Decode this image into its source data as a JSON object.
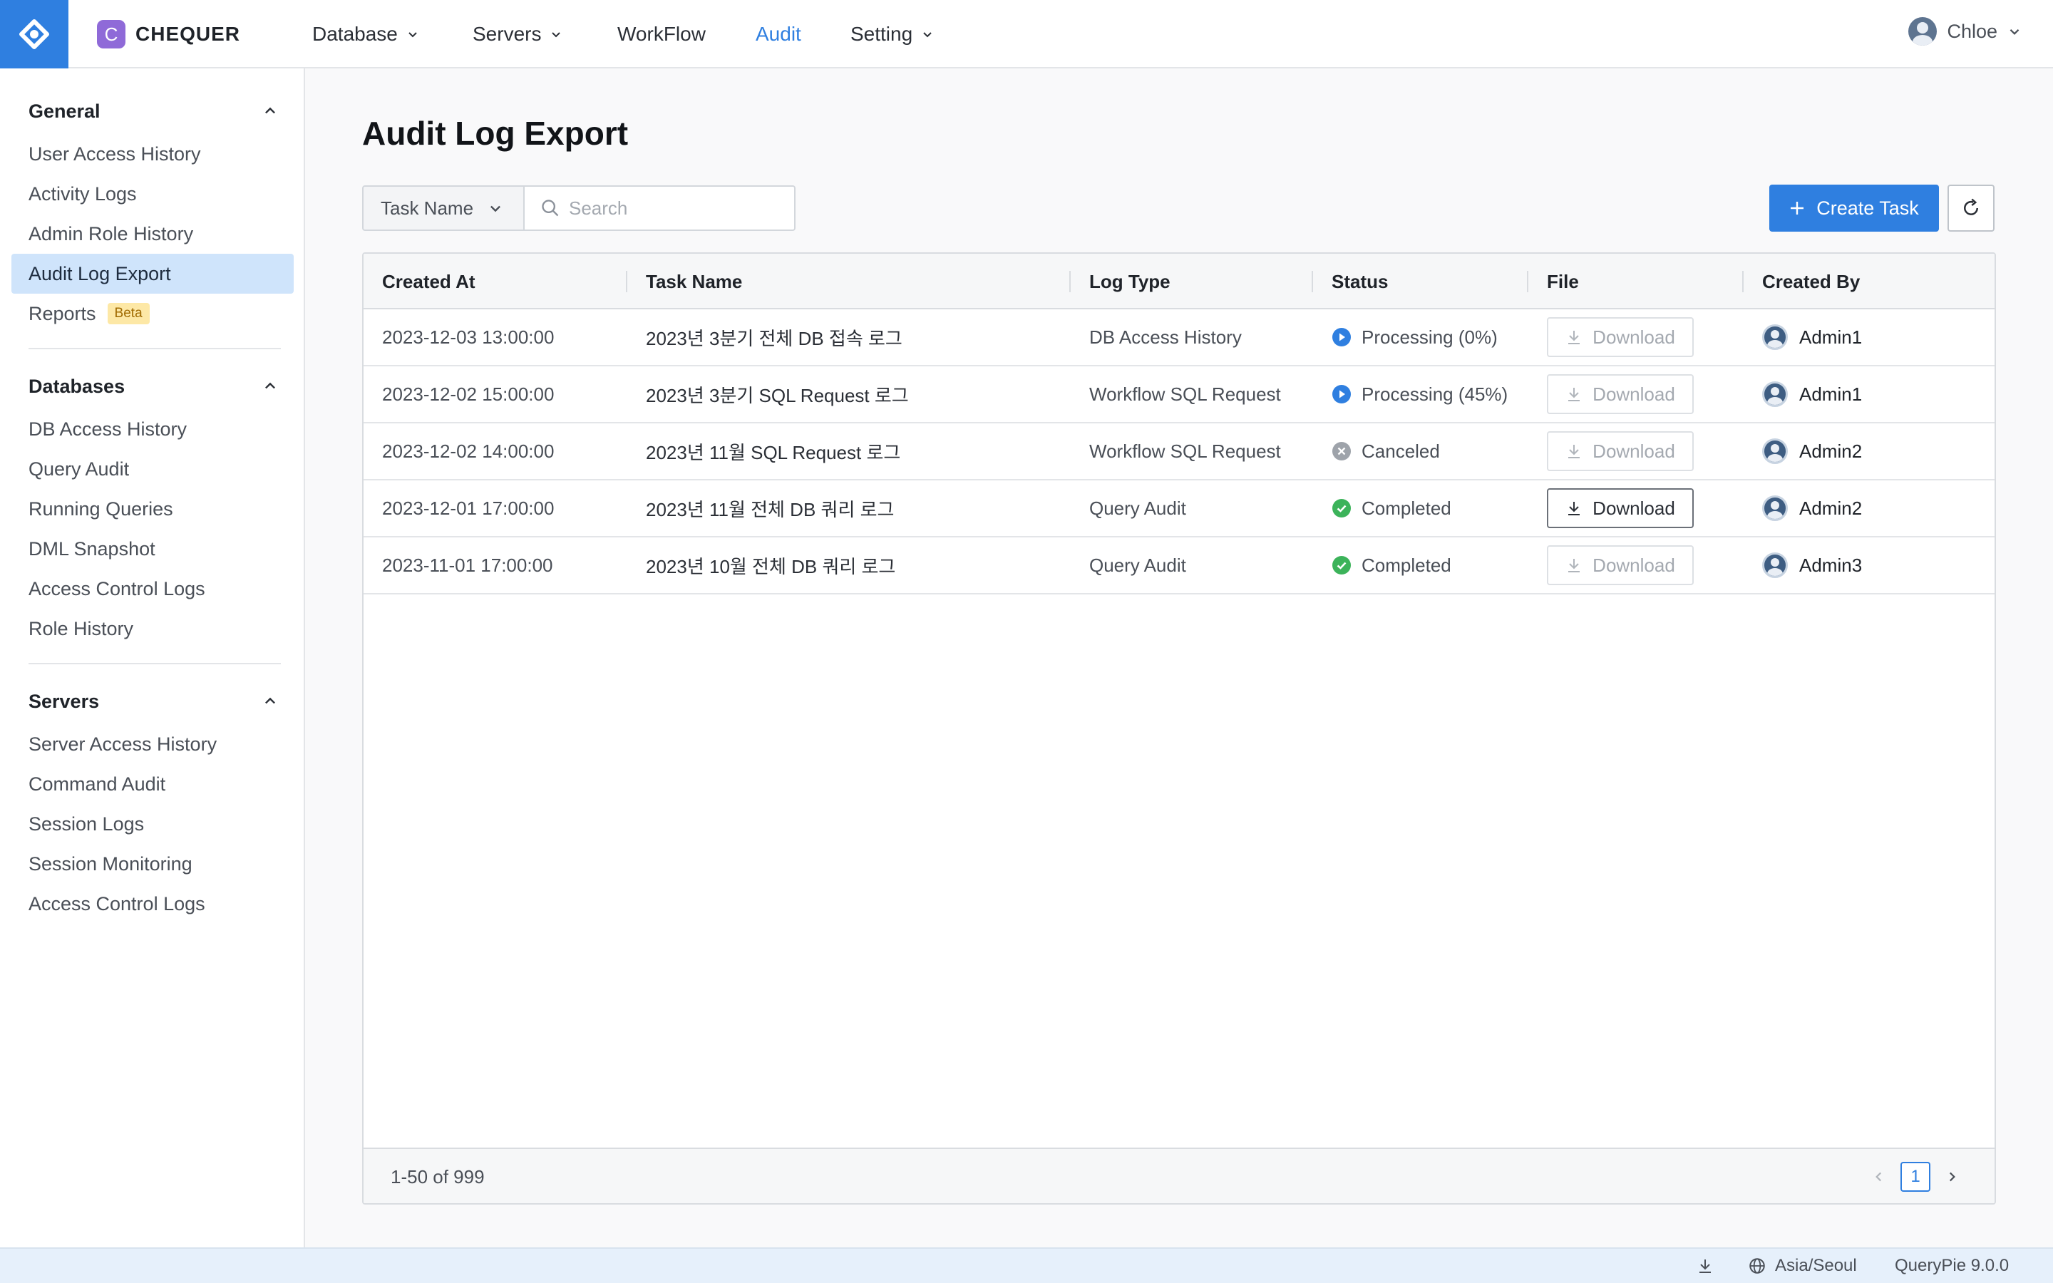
{
  "app": {
    "brand_letter": "C",
    "brand_name": "CHEQUER",
    "accent_color": "#2f7fe0"
  },
  "nav": {
    "items": [
      {
        "label": "Database",
        "has_dropdown": true,
        "active": false
      },
      {
        "label": "Servers",
        "has_dropdown": true,
        "active": false
      },
      {
        "label": "WorkFlow",
        "has_dropdown": false,
        "active": false
      },
      {
        "label": "Audit",
        "has_dropdown": false,
        "active": true
      },
      {
        "label": "Setting",
        "has_dropdown": true,
        "active": false
      }
    ],
    "user_name": "Chloe"
  },
  "sidebar": {
    "sections": [
      {
        "title": "General",
        "expanded": true,
        "items": [
          {
            "label": "User Access History"
          },
          {
            "label": "Activity Logs"
          },
          {
            "label": "Admin Role History"
          },
          {
            "label": "Audit Log Export",
            "active": true
          },
          {
            "label": "Reports",
            "badge": "Beta"
          }
        ]
      },
      {
        "title": "Databases",
        "expanded": true,
        "items": [
          {
            "label": "DB Access History"
          },
          {
            "label": "Query Audit"
          },
          {
            "label": "Running Queries"
          },
          {
            "label": "DML Snapshot"
          },
          {
            "label": "Access Control Logs"
          },
          {
            "label": "Role History"
          }
        ]
      },
      {
        "title": "Servers",
        "expanded": true,
        "items": [
          {
            "label": "Server Access History"
          },
          {
            "label": "Command Audit"
          },
          {
            "label": "Session Logs"
          },
          {
            "label": "Session Monitoring"
          },
          {
            "label": "Access Control Logs"
          }
        ]
      }
    ]
  },
  "main": {
    "title": "Audit Log Export",
    "filter": {
      "selected": "Task Name",
      "search_placeholder": "Search",
      "search_value": ""
    },
    "create_button": "Create Task",
    "refresh_icon": "refresh-icon",
    "table": {
      "columns": [
        "Created At",
        "Task Name",
        "Log Type",
        "Status",
        "File",
        "Created By"
      ],
      "rows": [
        {
          "created_at": "2023-12-03 13:00:00",
          "task_name": "2023년 3분기 전체 DB 접속 로그",
          "log_type": "DB Access History",
          "status": "Processing (0%)",
          "status_kind": "processing",
          "file_label": "Download",
          "file_enabled": false,
          "created_by": "Admin1"
        },
        {
          "created_at": "2023-12-02 15:00:00",
          "task_name": "2023년 3분기 SQL Request 로그",
          "log_type": "Workflow SQL Request",
          "status": "Processing (45%)",
          "status_kind": "processing",
          "file_label": "Download",
          "file_enabled": false,
          "created_by": "Admin1"
        },
        {
          "created_at": "2023-12-02 14:00:00",
          "task_name": "2023년 11월 SQL Request 로그",
          "log_type": "Workflow SQL Request",
          "status": "Canceled",
          "status_kind": "canceled",
          "file_label": "Download",
          "file_enabled": false,
          "created_by": "Admin2"
        },
        {
          "created_at": "2023-12-01 17:00:00",
          "task_name": "2023년 11월 전체 DB 쿼리 로그",
          "log_type": "Query Audit",
          "status": "Completed",
          "status_kind": "completed",
          "file_label": "Download",
          "file_enabled": true,
          "created_by": "Admin2"
        },
        {
          "created_at": "2023-11-01 17:00:00",
          "task_name": "2023년 10월 전체 DB 쿼리 로그",
          "log_type": "Query Audit",
          "status": "Completed",
          "status_kind": "completed",
          "file_label": "Download",
          "file_enabled": false,
          "created_by": "Admin3"
        }
      ],
      "status_colors": {
        "processing": "#2f7fe0",
        "canceled": "#9ea3aa",
        "completed": "#3cb35a"
      }
    },
    "pagination": {
      "range": "1-50 of 999",
      "current_page": "1"
    }
  },
  "statusbar": {
    "timezone": "Asia/Seoul",
    "version": "QueryPie 9.0.0"
  }
}
